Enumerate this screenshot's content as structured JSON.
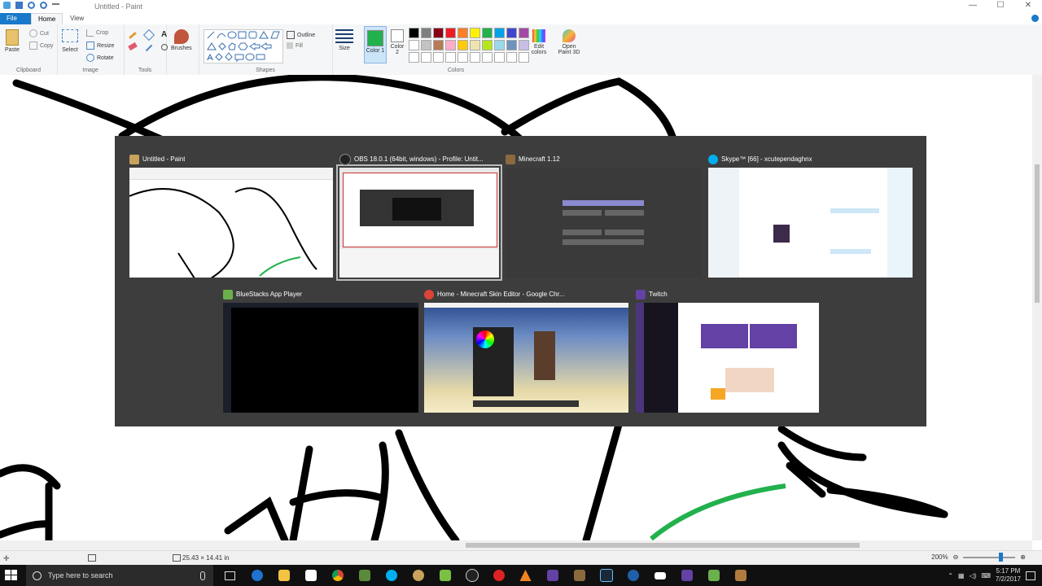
{
  "window": {
    "title": "Untitled - Paint"
  },
  "tabs": {
    "file": "File",
    "home": "Home",
    "view": "View"
  },
  "ribbon": {
    "clipboard": {
      "label": "Clipboard",
      "paste": "Paste",
      "cut": "Cut",
      "copy": "Copy"
    },
    "image": {
      "label": "Image",
      "select": "Select",
      "crop": "Crop",
      "resize": "Resize",
      "rotate": "Rotate"
    },
    "tools": {
      "label": "Tools"
    },
    "brushes": "Brushes",
    "shapes": {
      "label": "Shapes",
      "outline": "Outline",
      "fill": "Fill"
    },
    "size": "Size",
    "color1": "Color 1",
    "color2": "Color 2",
    "colors_label": "Colors",
    "edit_colors": "Edit colors",
    "open_paint3d": "Open Paint 3D"
  },
  "palette": [
    "#000000",
    "#7f7f7f",
    "#880015",
    "#ed1c24",
    "#ff7f27",
    "#fff200",
    "#22b14c",
    "#00a2e8",
    "#3f48cc",
    "#a349a4",
    "#ffffff",
    "#c3c3c3",
    "#b97a57",
    "#ffaec9",
    "#ffc90e",
    "#efe4b0",
    "#b5e61d",
    "#99d9ea",
    "#7092be",
    "#c8bfe7",
    "#ffffff",
    "#ffffff",
    "#ffffff",
    "#ffffff",
    "#ffffff",
    "#ffffff",
    "#ffffff",
    "#ffffff",
    "#ffffff",
    "#ffffff"
  ],
  "color1_value": "#22b14c",
  "color2_value": "#ffffff",
  "switcher": {
    "windows": [
      {
        "title": "Untitled - Paint",
        "icon_color": "#c9a35b"
      },
      {
        "title": "OBS 18.0.1 (64bit, windows) - Profile: Untit...",
        "icon_color": "#222222"
      },
      {
        "title": "Minecraft 1.12",
        "icon_color": "#8b6a3e"
      },
      {
        "title": "Skype™ [66] - xcutependaghnx",
        "icon_color": "#00aff0"
      },
      {
        "title": "BlueStacks App Player",
        "icon_color": "#6ab04c"
      },
      {
        "title": "Home - Minecraft Skin Editor - Google Chr...",
        "icon_color": "#db4437"
      },
      {
        "title": "Twitch",
        "icon_color": "#6441a4"
      }
    ]
  },
  "status": {
    "size": "25.43 × 14.41 in",
    "zoom": "200%"
  },
  "taskbar": {
    "search_placeholder": "Type here to search",
    "time": "5:17 PM",
    "date": "7/2/2017"
  }
}
